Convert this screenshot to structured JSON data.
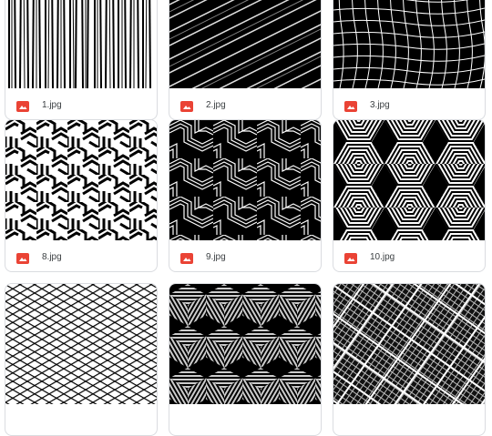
{
  "files": [
    {
      "name": "1.jpg",
      "icon": "image-file-icon"
    },
    {
      "name": "2.jpg",
      "icon": "image-file-icon"
    },
    {
      "name": "3.jpg",
      "icon": "image-file-icon"
    },
    {
      "name": "8.jpg",
      "icon": "image-file-icon"
    },
    {
      "name": "9.jpg",
      "icon": "image-file-icon"
    },
    {
      "name": "10.jpg",
      "icon": "image-file-icon"
    }
  ],
  "colors": {
    "icon_red": "#ea4335",
    "border": "#dadce0",
    "text": "#3c4043"
  }
}
